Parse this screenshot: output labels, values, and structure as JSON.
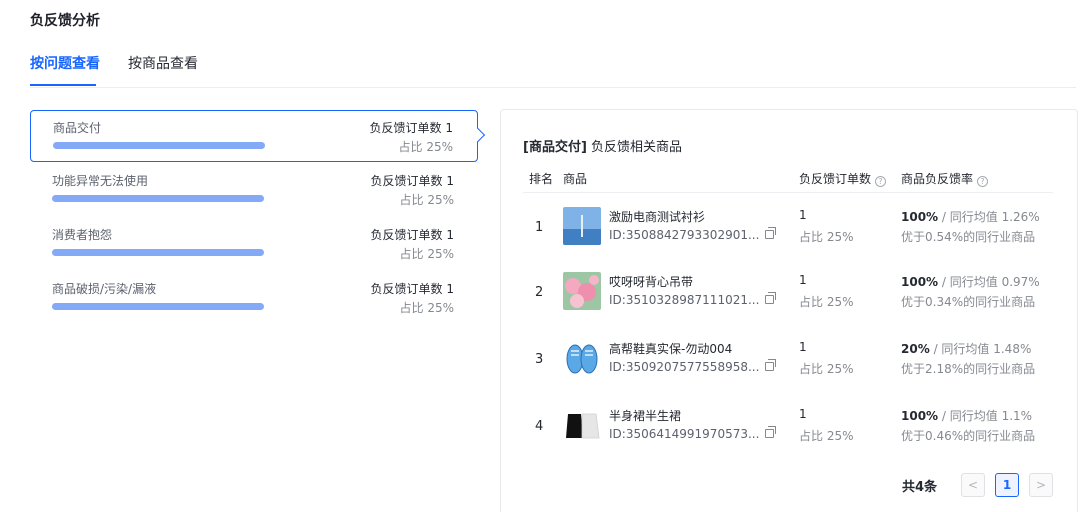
{
  "page": {
    "title": "负反馈分析"
  },
  "tabs": [
    {
      "label": "按问题查看",
      "active": true
    },
    {
      "label": "按商品查看",
      "active": false
    }
  ],
  "issues": [
    {
      "name": "商品交付",
      "count_label": "负反馈订单数 1",
      "ratio_label": "占比 25%",
      "share": 0.25,
      "selected": true
    },
    {
      "name": "功能异常无法使用",
      "count_label": "负反馈订单数 1",
      "ratio_label": "占比 25%",
      "share": 0.25,
      "selected": false
    },
    {
      "name": "消费者抱怨",
      "count_label": "负反馈订单数 1",
      "ratio_label": "占比 25%",
      "share": 0.25,
      "selected": false
    },
    {
      "name": "商品破损/污染/漏液",
      "count_label": "负反馈订单数 1",
      "ratio_label": "占比 25%",
      "share": 0.25,
      "selected": false
    }
  ],
  "panel": {
    "title_bracket": "[商品交付]",
    "title_rest": " 负反馈相关商品",
    "headers": {
      "rank": "排名",
      "product": "商品",
      "count": "负反馈订单数",
      "rate": "商品负反馈率"
    },
    "rows": [
      {
        "rank": "1",
        "name": "激励电商测试衬衫",
        "id": "ID:3508842793302901...",
        "count": "1",
        "count_ratio": "占比 25%",
        "rate": "100%",
        "industry_avg": "/ 同行均值 1.26%",
        "compare": "优于0.54%的同行业商品",
        "thumb": "blue-sky-image"
      },
      {
        "rank": "2",
        "name": "哎呀呀背心吊带",
        "id": "ID:3510328987111021...",
        "count": "1",
        "count_ratio": "占比 25%",
        "rate": "100%",
        "industry_avg": "/ 同行均值 0.97%",
        "compare": "优于0.34%的同行业商品",
        "thumb": "pink-flowers-image"
      },
      {
        "rank": "3",
        "name": "高帮鞋真实保-勿动004",
        "id": "ID:3509207577558958...",
        "count": "1",
        "count_ratio": "占比 25%",
        "rate": "20%",
        "industry_avg": "/ 同行均值 1.48%",
        "compare": "优于2.18%的同行业商品",
        "thumb": "blue-sneakers-image"
      },
      {
        "rank": "4",
        "name": "半身裙半生裙",
        "id": "ID:3506414991970573...",
        "count": "1",
        "count_ratio": "占比 25%",
        "rate": "100%",
        "industry_avg": "/ 同行均值 1.1%",
        "compare": "优于0.46%的同行业商品",
        "thumb": "black-white-skirt-image"
      }
    ],
    "pagination": {
      "total": "共4条",
      "prev": "<",
      "current": "1",
      "next": ">"
    }
  },
  "colors": {
    "accent": "#1966ff",
    "bar": "#84a9f6"
  }
}
